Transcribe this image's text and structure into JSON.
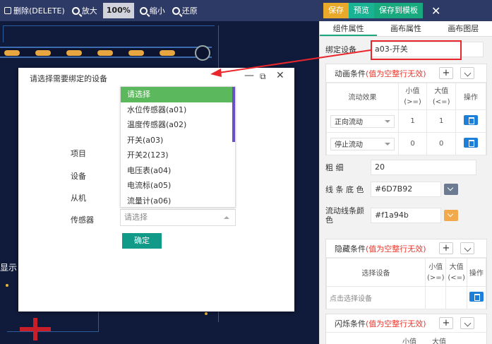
{
  "toolbar": {
    "delete_label": "删除(DELETE)",
    "zoom_in_label": "放大",
    "zoom_value": "100%",
    "zoom_out_label": "缩小",
    "restore_label": "还原"
  },
  "canvas": {
    "partial_text": "显示"
  },
  "right_top": {
    "save_label": "保存",
    "preview_label": "预览",
    "save_template_label": "保存到模板"
  },
  "tabs": [
    "组件属性",
    "画布属性",
    "画布图层"
  ],
  "bind_device": {
    "label": "绑定设备",
    "value": "a03-开关"
  },
  "animation": {
    "title": "动画条件",
    "warning": "(值为空整行无效)",
    "headers": {
      "effect": "流动效果",
      "min": "小值",
      "min_hint": "(>=)",
      "max": "大值",
      "max_hint": "(<=)",
      "op": "操作"
    },
    "rows": [
      {
        "effect": "正向流动",
        "min": "1",
        "max": "1"
      },
      {
        "effect": "停止流动",
        "min": "0",
        "max": "0"
      }
    ]
  },
  "thickness": {
    "label": "粗 细",
    "value": "20"
  },
  "line_bg_color": {
    "label": "线 条 底 色",
    "value": "#6D7B92",
    "color": "#6D7B92"
  },
  "flow_color": {
    "label": "流动线条颜色",
    "value": "#f1a94b",
    "color": "#f1a94b"
  },
  "hide": {
    "title": "隐藏条件",
    "warning": "(值为空整行无效)",
    "headers": {
      "device": "选择设备",
      "min": "小值",
      "min_hint": "(>=)",
      "max": "大值",
      "max_hint": "(<=)",
      "op": "操作"
    },
    "device_placeholder": "点击选择设备"
  },
  "flash": {
    "title": "闪烁条件",
    "warning": "(值为空整行无效)",
    "min": "小值",
    "max": "大值"
  },
  "modal": {
    "title": "请选择需要绑定的设备",
    "labels": {
      "item": "项目",
      "device": "设备",
      "slave": "从机",
      "sensor": "传感器"
    },
    "sensor_placeholder": "请选择",
    "confirm_label": "确定",
    "options": [
      "请选择",
      "水位传感器(a01)",
      "温度传感器(a02)",
      "开关(a03)",
      "开关2(123)",
      "电压表(a04)",
      "电流标(a05)",
      "流量计(a06)"
    ]
  },
  "colors": {
    "accent": "#19a97e",
    "toolbar": "#2e3a66",
    "warn": "#e83a30",
    "highlight": "#e8262c"
  }
}
